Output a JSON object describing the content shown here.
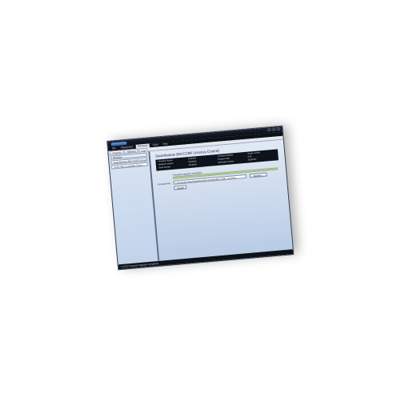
{
  "window": {
    "title": "",
    "menu": [
      "File",
      "Diagnostics",
      "Firmware",
      "Tools",
      "Help"
    ],
    "tabs": [
      "Modules",
      "Network",
      "Log"
    ]
  },
  "sidebar": {
    "items": [
      "Modules",
      "SkuleModule BM-CCMF (Access...",
      "CCM- Bus Controller (Door..."
    ]
  },
  "main": {
    "title": "SkuleModule BM-CCMF (Access Control)",
    "info": [
      "Firmware Version",
      "20130402",
      "Firmware Revision",
      "Access Control",
      "Hardware Version",
      "20130402",
      "Product Code",
      "4134",
      "Serial Number",
      "20130402",
      "Bootloader Version",
      "20130402"
    ],
    "status_label": "Firmware upgrade completed.",
    "progress": 1.0,
    "file_label": "Firmware file",
    "file_value": "C:\\Program Files\\SkuleModule\\Firmware\\BM-CCMF_v4.0.hex",
    "browse_label": "Browse...",
    "update_label": "Update"
  },
  "statusbar": {
    "text": "© 2013 Firmware Upgrade Completed"
  },
  "colors": {
    "window_frame": "#0d1219",
    "panel_blue": "#c2d3ea",
    "progress_green": "#b7d48a"
  }
}
